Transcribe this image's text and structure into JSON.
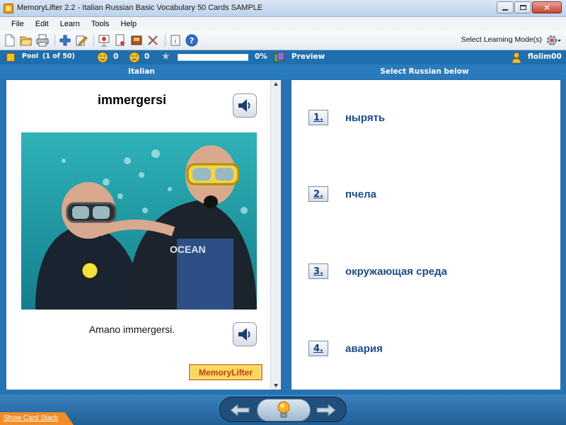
{
  "window": {
    "title": "MemoryLifter 2.2 - Italian Russian Basic Vocabulary 50 Cards SAMPLE",
    "controls": [
      "minimize-icon",
      "maximize-icon",
      "close-icon"
    ]
  },
  "menu": {
    "items": [
      "File",
      "Edit",
      "Learn",
      "Tools",
      "Help"
    ]
  },
  "toolbar": {
    "icons": [
      "new-icon",
      "open-icon",
      "print-icon",
      "add-card-icon",
      "edit-icon",
      "presentation-icon",
      "print-preview-icon",
      "book-icon",
      "tools-icon",
      "info-icon",
      "help-icon"
    ],
    "learning_mode_label": "Select Learning Mode(s)",
    "learning_mode_icon": "gear-icon"
  },
  "status": {
    "pool_label": "Pool",
    "pool_count": "(1 of 50)",
    "correct_count": "0",
    "wrong_count": "0",
    "progress_percent": 0,
    "progress_text": "0%",
    "preview_label": "Preview",
    "user_name": "flolim00"
  },
  "columns": {
    "left_header": "Italian",
    "right_header": "Select Russian below"
  },
  "card": {
    "word": "immergersi",
    "sentence": "Amano immergersi.",
    "logo_text": "MemoryLifter"
  },
  "answers": [
    {
      "number": "1.",
      "text": "нырять"
    },
    {
      "number": "2.",
      "text": "пчела"
    },
    {
      "number": "3.",
      "text": "окружающая среда"
    },
    {
      "number": "4.",
      "text": "авария"
    }
  ],
  "bottom": {
    "show_stack_label": "Show Card Stack"
  },
  "colors": {
    "status_blue": "#1f6fae",
    "panel_blue": "#2672b3",
    "answer_text": "#1a4c8a",
    "accent_orange": "#f28c28"
  }
}
